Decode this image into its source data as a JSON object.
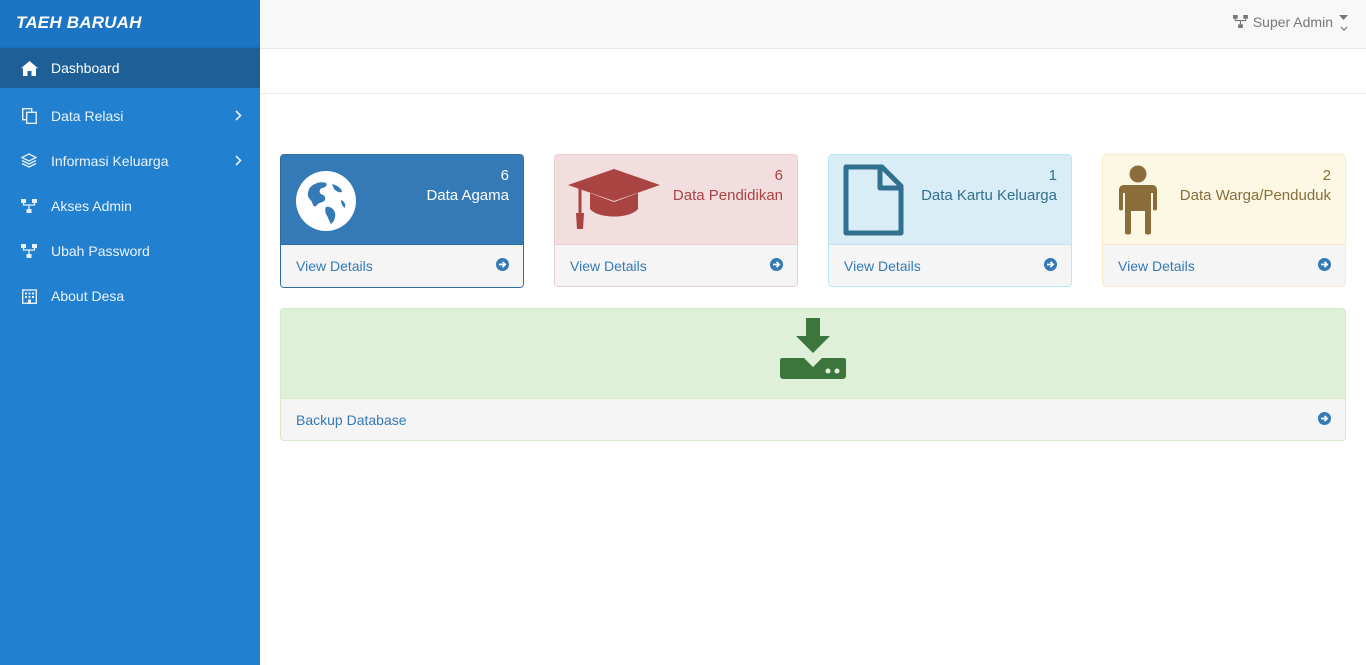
{
  "brand": "TAEH BARUAH",
  "sidebar": {
    "items": [
      {
        "label": "Dashboard",
        "icon": "home-icon"
      },
      {
        "label": "Data Relasi",
        "icon": "copy-icon"
      },
      {
        "label": "Informasi Keluarga",
        "icon": "layers-icon"
      },
      {
        "label": "Akses Admin",
        "icon": "sitemap-icon"
      },
      {
        "label": "Ubah Password",
        "icon": "sitemap-icon"
      },
      {
        "label": "About Desa",
        "icon": "building-icon"
      }
    ]
  },
  "topbar": {
    "user": "Super Admin"
  },
  "cards": [
    {
      "count": "6",
      "label": "Data Agama",
      "link": "View Details",
      "icon": "globe-icon"
    },
    {
      "count": "6",
      "label": "Data Pendidikan",
      "link": "View Details",
      "icon": "graduation-cap-icon"
    },
    {
      "count": "1",
      "label": "Data Kartu Keluarga",
      "link": "View Details",
      "icon": "file-icon"
    },
    {
      "count": "2",
      "label": "Data Warga/Penduduk",
      "link": "View Details",
      "icon": "person-icon"
    }
  ],
  "backup": {
    "label": "Backup Database",
    "icon": "download-icon"
  },
  "colors": {
    "sidebar": "#2280d0",
    "sidebar_active": "#1e5f98",
    "primary": "#337ab7",
    "danger_text": "#a94442",
    "info_text": "#31708f",
    "warning_text": "#8a6d3b",
    "success_icon": "#3c763d"
  }
}
